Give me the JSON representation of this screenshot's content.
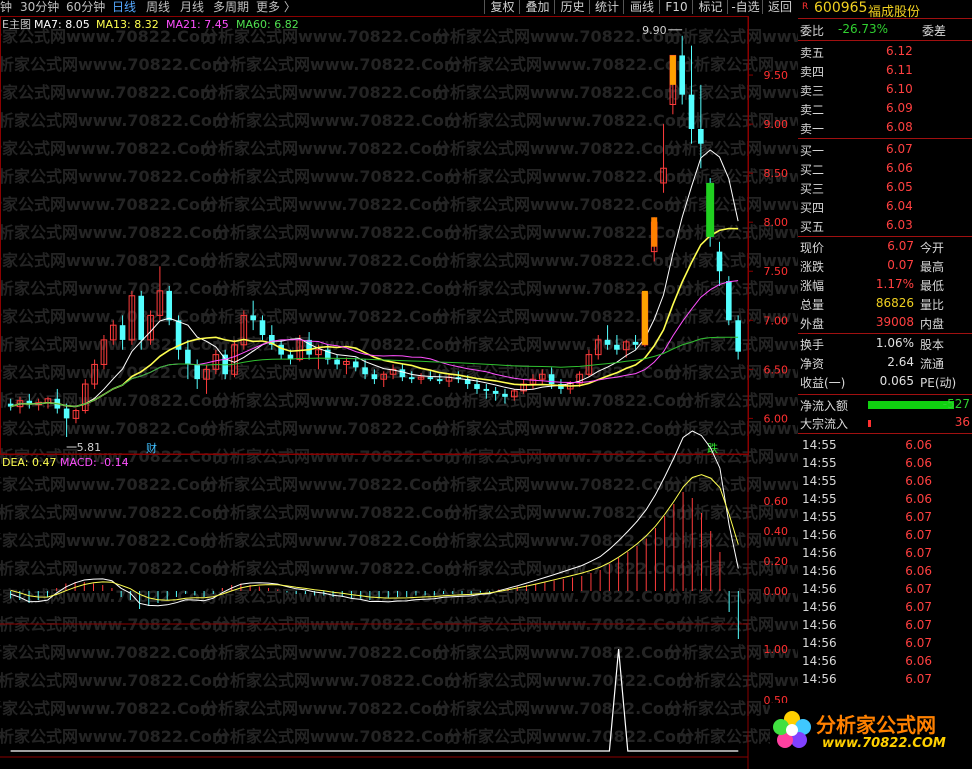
{
  "toolbar": {
    "timeframes": [
      {
        "label": "钟",
        "active": false
      },
      {
        "label": "30分钟",
        "active": false
      },
      {
        "label": "60分钟",
        "active": false
      },
      {
        "label": "日线",
        "active": true
      },
      {
        "label": "周线",
        "active": false
      },
      {
        "label": "月线",
        "active": false
      },
      {
        "label": "多周期",
        "active": false
      },
      {
        "label": "更多 〉",
        "active": false
      }
    ],
    "buttons": [
      "复权",
      "叠加",
      "历史",
      "统计",
      "画线",
      "F10",
      "标记",
      "-自选",
      "返回"
    ]
  },
  "main_legend": {
    "prefix": "E主图",
    "ma7": "MA7: 8.05",
    "ma13": "MA13: 8.32",
    "ma21": "MA21: 7.45",
    "ma60": "MA60: 6.82"
  },
  "macd_legend": {
    "dea": "DEA: 0.47",
    "macd": "MACD: -0.14"
  },
  "annotations": {
    "high_label": "9.90",
    "low_label": "5.81",
    "cai_marker": "财",
    "die_marker": "跌"
  },
  "watermark": {
    "text": "分析家公式网www.70822.Com"
  },
  "quote": {
    "flag": "R",
    "code": "600965",
    "name": "福成股份",
    "weibi_label": "委比",
    "weibi_value": "-26.73%",
    "weicha_label": "委差",
    "sells": [
      {
        "label": "卖五",
        "price": "6.12"
      },
      {
        "label": "卖四",
        "price": "6.11"
      },
      {
        "label": "卖三",
        "price": "6.10"
      },
      {
        "label": "卖二",
        "price": "6.09"
      },
      {
        "label": "卖一",
        "price": "6.08"
      }
    ],
    "buys": [
      {
        "label": "买一",
        "price": "6.07"
      },
      {
        "label": "买二",
        "price": "6.06"
      },
      {
        "label": "买三",
        "price": "6.05"
      },
      {
        "label": "买四",
        "price": "6.04"
      },
      {
        "label": "买五",
        "price": "6.03"
      }
    ],
    "stats": [
      {
        "label": "现价",
        "value": "6.07",
        "label2": "今开"
      },
      {
        "label": "涨跌",
        "value": "0.07",
        "label2": "最高"
      },
      {
        "label": "涨幅",
        "value": "1.17%",
        "label2": "最低"
      },
      {
        "label": "总量",
        "value": "86826",
        "label2": "量比"
      },
      {
        "label": "外盘",
        "value": "39008",
        "label2": "内盘"
      }
    ],
    "fund": [
      {
        "label": "换手",
        "value": "1.06%",
        "label2": "股本"
      },
      {
        "label": "净资",
        "value": "2.64",
        "label2": "流通"
      },
      {
        "label": "收益(一)",
        "value": "0.065",
        "label2": "PE(动)"
      }
    ],
    "netflow_label": "净流入额",
    "netflow_value": "-527",
    "block_label": "大宗流入",
    "block_value": "36"
  },
  "ticks": [
    {
      "time": "14:55",
      "price": "6.06"
    },
    {
      "time": "14:55",
      "price": "6.06"
    },
    {
      "time": "14:55",
      "price": "6.06"
    },
    {
      "time": "14:55",
      "price": "6.06"
    },
    {
      "time": "14:55",
      "price": "6.07"
    },
    {
      "time": "14:56",
      "price": "6.07"
    },
    {
      "time": "14:56",
      "price": "6.07"
    },
    {
      "time": "14:56",
      "price": "6.06"
    },
    {
      "time": "14:56",
      "price": "6.07"
    },
    {
      "time": "14:56",
      "price": "6.07"
    },
    {
      "time": "14:56",
      "price": "6.07"
    },
    {
      "time": "14:56",
      "price": "6.07"
    },
    {
      "time": "14:56",
      "price": "6.06"
    },
    {
      "time": "14:56",
      "price": "6.07"
    }
  ],
  "logo": {
    "text": "分析家公式网",
    "url": "www.70822.COM"
  },
  "colors": {
    "up": "#ff3c3c",
    "down": "#54ffff",
    "ma7": "#ffffff",
    "ma13": "#ffff50",
    "ma21": "#ff50ff",
    "ma60": "#30c030",
    "grid": "#8b0000"
  },
  "chart_data": [
    {
      "type": "candlestick",
      "title": "",
      "ylim": [
        5.8,
        10.0
      ],
      "yticks": [
        "9.50",
        "9.00",
        "8.50",
        "8.00",
        "7.50",
        "7.00",
        "6.50",
        "6.00"
      ],
      "ytick_values": [
        9.5,
        9.0,
        8.5,
        8.0,
        7.5,
        7.0,
        6.5,
        6.0
      ],
      "candles": [
        [
          6.15,
          6.2,
          6.08,
          6.12
        ],
        [
          6.12,
          6.22,
          6.05,
          6.18
        ],
        [
          6.18,
          6.25,
          6.1,
          6.14
        ],
        [
          6.14,
          6.2,
          6.08,
          6.16
        ],
        [
          6.16,
          6.22,
          6.1,
          6.2
        ],
        [
          6.2,
          6.3,
          6.05,
          6.1
        ],
        [
          6.1,
          6.15,
          5.81,
          6.0
        ],
        [
          6.0,
          6.1,
          5.95,
          6.08
        ],
        [
          6.08,
          6.4,
          6.05,
          6.35
        ],
        [
          6.35,
          6.6,
          6.3,
          6.55
        ],
        [
          6.55,
          6.85,
          6.5,
          6.8
        ],
        [
          6.8,
          7.0,
          6.75,
          6.95
        ],
        [
          6.95,
          7.05,
          6.7,
          6.8
        ],
        [
          6.8,
          7.3,
          6.75,
          7.25
        ],
        [
          7.25,
          7.3,
          6.7,
          6.8
        ],
        [
          6.8,
          7.1,
          6.75,
          7.05
        ],
        [
          7.05,
          7.55,
          7.0,
          7.3
        ],
        [
          7.3,
          7.35,
          6.95,
          7.0
        ],
        [
          7.0,
          7.05,
          6.6,
          6.7
        ],
        [
          6.7,
          6.8,
          6.4,
          6.55
        ],
        [
          6.55,
          6.6,
          6.3,
          6.4
        ],
        [
          6.4,
          6.55,
          6.25,
          6.5
        ],
        [
          6.5,
          6.7,
          6.45,
          6.65
        ],
        [
          6.65,
          6.7,
          6.4,
          6.45
        ],
        [
          6.45,
          6.8,
          6.42,
          6.75
        ],
        [
          6.75,
          7.1,
          6.7,
          7.05
        ],
        [
          7.05,
          7.2,
          6.9,
          7.0
        ],
        [
          7.0,
          7.05,
          6.8,
          6.85
        ],
        [
          6.85,
          6.95,
          6.7,
          6.75
        ],
        [
          6.75,
          6.8,
          6.6,
          6.65
        ],
        [
          6.65,
          6.7,
          6.55,
          6.6
        ],
        [
          6.6,
          6.85,
          6.58,
          6.8
        ],
        [
          6.8,
          6.88,
          6.6,
          6.65
        ],
        [
          6.65,
          6.75,
          6.5,
          6.7
        ],
        [
          6.7,
          6.75,
          6.55,
          6.6
        ],
        [
          6.6,
          6.65,
          6.5,
          6.55
        ],
        [
          6.55,
          6.62,
          6.45,
          6.58
        ],
        [
          6.58,
          6.62,
          6.48,
          6.52
        ],
        [
          6.52,
          6.6,
          6.4,
          6.45
        ],
        [
          6.45,
          6.5,
          6.35,
          6.4
        ],
        [
          6.4,
          6.48,
          6.32,
          6.45
        ],
        [
          6.45,
          6.55,
          6.4,
          6.5
        ],
        [
          6.5,
          6.55,
          6.38,
          6.42
        ],
        [
          6.42,
          6.48,
          6.36,
          6.4
        ],
        [
          6.4,
          6.46,
          6.35,
          6.42
        ],
        [
          6.42,
          6.48,
          6.38,
          6.4
        ],
        [
          6.4,
          6.45,
          6.35,
          6.38
        ],
        [
          6.38,
          6.45,
          6.32,
          6.42
        ],
        [
          6.42,
          6.48,
          6.36,
          6.4
        ],
        [
          6.4,
          6.44,
          6.3,
          6.35
        ],
        [
          6.35,
          6.4,
          6.25,
          6.3
        ],
        [
          6.3,
          6.35,
          6.2,
          6.28
        ],
        [
          6.28,
          6.32,
          6.18,
          6.25
        ],
        [
          6.25,
          6.3,
          6.15,
          6.22
        ],
        [
          6.22,
          6.3,
          6.18,
          6.28
        ],
        [
          6.28,
          6.4,
          6.25,
          6.35
        ],
        [
          6.35,
          6.45,
          6.3,
          6.4
        ],
        [
          6.4,
          6.5,
          6.35,
          6.45
        ],
        [
          6.45,
          6.52,
          6.3,
          6.35
        ],
        [
          6.35,
          6.4,
          6.25,
          6.3
        ],
        [
          6.3,
          6.38,
          6.25,
          6.36
        ],
        [
          6.36,
          6.48,
          6.32,
          6.45
        ],
        [
          6.45,
          6.7,
          6.42,
          6.65
        ],
        [
          6.65,
          6.85,
          6.6,
          6.8
        ],
        [
          6.8,
          6.95,
          6.7,
          6.75
        ],
        [
          6.75,
          6.85,
          6.65,
          6.7
        ],
        [
          6.7,
          6.8,
          6.62,
          6.78
        ],
        [
          6.78,
          6.85,
          6.7,
          6.75
        ],
        [
          6.75,
          7.3,
          6.73,
          7.28
        ],
        [
          7.7,
          8.05,
          7.6,
          8.0
        ],
        [
          8.4,
          9.0,
          8.3,
          8.55
        ],
        [
          9.2,
          9.7,
          9.1,
          9.7
        ],
        [
          9.7,
          9.9,
          9.2,
          9.3
        ],
        [
          9.3,
          9.8,
          8.8,
          8.95
        ],
        [
          8.95,
          9.4,
          8.55,
          8.8
        ],
        [
          8.4,
          8.45,
          7.75,
          7.85
        ],
        [
          7.7,
          7.8,
          7.35,
          7.5
        ],
        [
          7.4,
          7.45,
          6.95,
          7.0
        ],
        [
          7.0,
          7.05,
          6.6,
          6.68
        ]
      ],
      "moving_averages": [
        {
          "name": "MA7",
          "color": "#ffffff"
        },
        {
          "name": "MA13",
          "color": "#ffff50"
        },
        {
          "name": "MA21",
          "color": "#ff50ff"
        },
        {
          "name": "MA60",
          "color": "#30c030"
        }
      ]
    },
    {
      "type": "bar",
      "title": "",
      "ylim": [
        -0.35,
        0.7
      ],
      "yticks": [
        "0.60",
        "0.40",
        "0.20",
        "0.00"
      ],
      "ytick_values": [
        0.6,
        0.4,
        0.2,
        0.0
      ],
      "series": [
        {
          "name": "MACD",
          "values": [
            -0.05,
            -0.06,
            -0.08,
            -0.06,
            -0.04,
            0.02,
            0.05,
            0.06,
            0.06,
            0.05,
            0.04,
            0.02,
            -0.04,
            -0.06,
            -0.12,
            -0.1,
            -0.08,
            -0.06,
            -0.04,
            -0.02,
            -0.03,
            -0.04,
            -0.02,
            0.02,
            0.04,
            0.05,
            0.04,
            0.03,
            0.02,
            0.01,
            -0.01,
            -0.02,
            -0.02,
            -0.03,
            -0.03,
            -0.04,
            -0.04,
            -0.05,
            -0.05,
            -0.06,
            -0.05,
            -0.05,
            -0.04,
            -0.04,
            -0.03,
            -0.03,
            -0.03,
            -0.02,
            -0.02,
            -0.02,
            -0.02,
            -0.01,
            -0.01,
            0.01,
            0.02,
            0.03,
            0.04,
            0.05,
            0.06,
            0.07,
            0.08,
            0.09,
            0.1,
            0.12,
            0.14,
            0.18,
            0.22,
            0.26,
            0.3,
            0.35,
            0.42,
            0.5,
            0.58,
            0.66,
            0.62,
            0.52,
            0.4,
            0.26,
            -0.14,
            -0.32
          ]
        }
      ]
    },
    {
      "type": "line",
      "title": "",
      "ylim": [
        0,
        1.1
      ],
      "yticks": [
        "1.00",
        "0.50"
      ],
      "ytick_values": [
        1.0,
        0.5
      ],
      "series": [
        {
          "name": "",
          "values": [
            0,
            0,
            0,
            0,
            0,
            0,
            0,
            0,
            0,
            0,
            0,
            0,
            0,
            0,
            0,
            0,
            0,
            0,
            0,
            0,
            0,
            0,
            0,
            0,
            0,
            0,
            0,
            0,
            0,
            0,
            0,
            0,
            0,
            0,
            0,
            0,
            0,
            0,
            0,
            0,
            0,
            0,
            0,
            0,
            0,
            0,
            0,
            0,
            0,
            0,
            0,
            0,
            0,
            0,
            0,
            0,
            0,
            0,
            0,
            0,
            0,
            0,
            0,
            0,
            0,
            0,
            1,
            0,
            0,
            0,
            0,
            0,
            0,
            0,
            0,
            0,
            0,
            0,
            0,
            0
          ]
        }
      ]
    }
  ]
}
